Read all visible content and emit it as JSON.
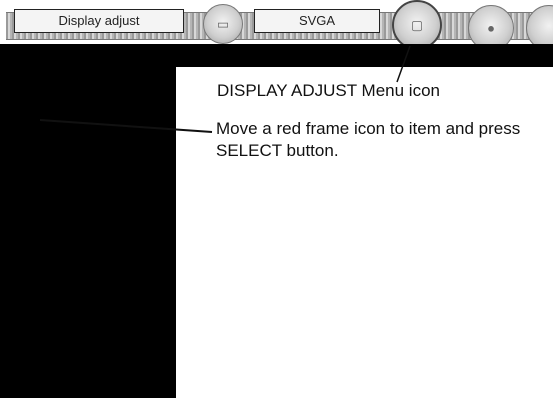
{
  "menu_bar": {
    "left_field": "Display adjust",
    "right_field": "SVGA",
    "icons": [
      "pc-adjust-icon",
      "display-adjust-icon",
      "next-menu-icon",
      "cut-off-icon"
    ]
  },
  "callouts": {
    "menu_icon_label": "DISPLAY ADJUST Menu icon",
    "instruction": "Move a red frame icon to item and press SELECT button."
  }
}
